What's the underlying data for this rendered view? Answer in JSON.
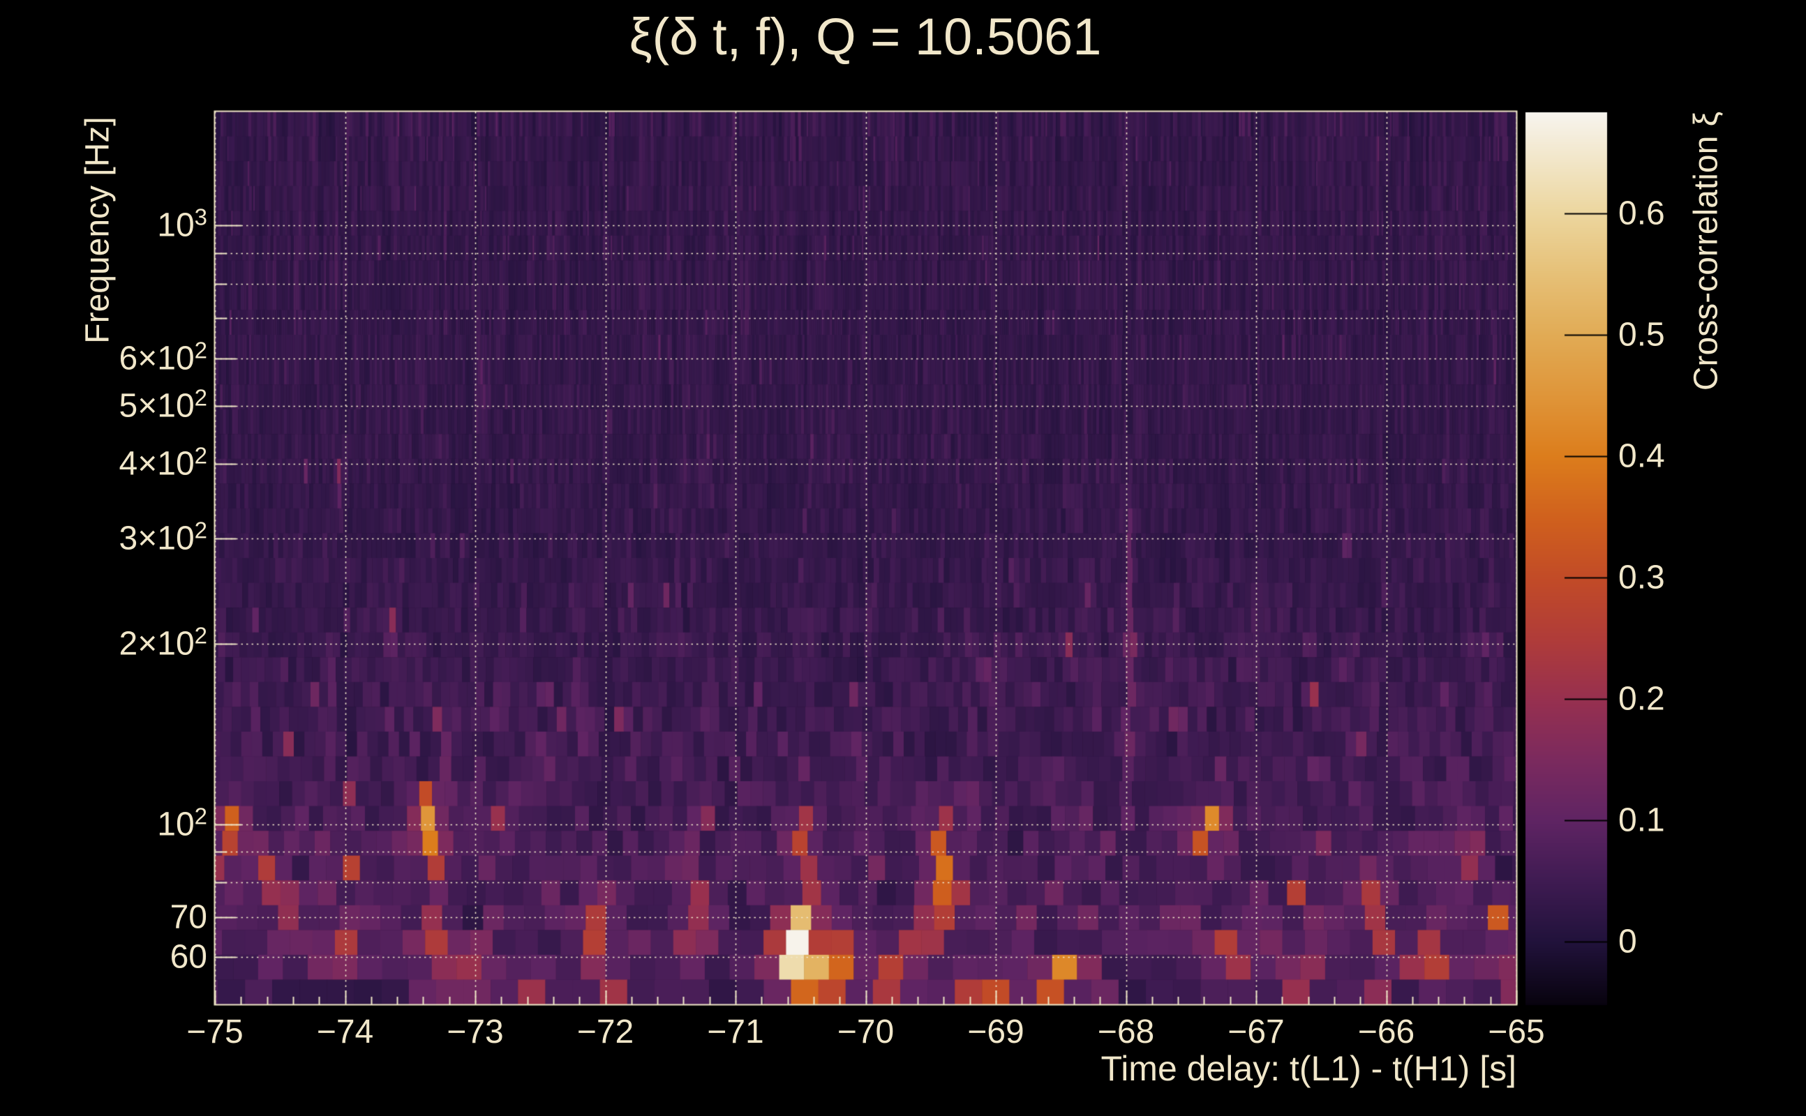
{
  "colors": {
    "background": "#000000",
    "text": "#f1e7ca",
    "grid": "#f1e7ca",
    "frame": "#efe6c6",
    "colorbar_tick": "#000000"
  },
  "chart_data": {
    "type": "heatmap",
    "title": "ξ(δ t, f), Q = 10.5061",
    "q_value": 10.5061,
    "xlabel": "Time delay: t(L1) - t(H1) [s]",
    "ylabel": "Frequency [Hz]",
    "colorbar_label": "Cross-correlation ξ",
    "x_range_s": [
      -75,
      -65
    ],
    "x_minor_tick_step_s": 0.2,
    "y_range_hz": [
      50,
      1550
    ],
    "y_scale": "log",
    "grid": "dotted, at every labeled/decade-minor tick",
    "legend_position": "right colorbar",
    "x_ticks": [
      {
        "v": -75,
        "label": "−75"
      },
      {
        "v": -74,
        "label": "−74"
      },
      {
        "v": -73,
        "label": "−73"
      },
      {
        "v": -72,
        "label": "−72"
      },
      {
        "v": -71,
        "label": "−71"
      },
      {
        "v": -70,
        "label": "−70"
      },
      {
        "v": -69,
        "label": "−69"
      },
      {
        "v": -68,
        "label": "−68"
      },
      {
        "v": -67,
        "label": "−67"
      },
      {
        "v": -66,
        "label": "−66"
      },
      {
        "v": -65,
        "label": "−65"
      }
    ],
    "y_ticks": [
      {
        "v": 1000,
        "base": "10",
        "exp": "3"
      },
      {
        "v": 600,
        "base": "6×10",
        "exp": "2"
      },
      {
        "v": 500,
        "base": "5×10",
        "exp": "2"
      },
      {
        "v": 400,
        "base": "4×10",
        "exp": "2"
      },
      {
        "v": 300,
        "base": "3×10",
        "exp": "2"
      },
      {
        "v": 200,
        "base": "2×10",
        "exp": "2"
      },
      {
        "v": 100,
        "base": "10",
        "exp": "2"
      },
      {
        "v": 70,
        "label": "70"
      },
      {
        "v": 60,
        "label": "60"
      }
    ],
    "y_unlabeled_ticks_hz": [
      80,
      90,
      700,
      800,
      900
    ],
    "y_gridlines_hz": [
      60,
      70,
      80,
      90,
      100,
      200,
      300,
      400,
      500,
      600,
      700,
      800,
      900,
      1000
    ],
    "colorbar": {
      "vmin": -0.052,
      "vmax": 0.683,
      "ticks": [
        {
          "v": 0.6,
          "label": "0.6"
        },
        {
          "v": 0.5,
          "label": "0.5"
        },
        {
          "v": 0.4,
          "label": "0.4"
        },
        {
          "v": 0.3,
          "label": "0.3"
        },
        {
          "v": 0.2,
          "label": "0.2"
        },
        {
          "v": 0.1,
          "label": "0.1"
        },
        {
          "v": 0.0,
          "label": "0"
        }
      ]
    },
    "colormap_stops": [
      [
        -0.052,
        "#08030e"
      ],
      [
        0.0,
        "#21123b"
      ],
      [
        0.05,
        "#3f1b52"
      ],
      [
        0.1,
        "#5f2463"
      ],
      [
        0.15,
        "#7b2a5e"
      ],
      [
        0.2,
        "#97304f"
      ],
      [
        0.25,
        "#b03c39"
      ],
      [
        0.3,
        "#c24b27"
      ],
      [
        0.35,
        "#d0611d"
      ],
      [
        0.4,
        "#dc7d1c"
      ],
      [
        0.45,
        "#df9539"
      ],
      [
        0.5,
        "#e1ab55"
      ],
      [
        0.55,
        "#e6c077"
      ],
      [
        0.6,
        "#ecd69e"
      ],
      [
        0.683,
        "#f7f4ee"
      ]
    ],
    "features": [
      {
        "t": -74.91,
        "f1": 88,
        "f2": 112,
        "v": 0.4
      },
      {
        "t": -74.6,
        "f1": 72,
        "f2": 95,
        "v": 0.27
      },
      {
        "t": -74.42,
        "f1": 62,
        "f2": 82,
        "v": 0.22
      },
      {
        "t": -74.3,
        "f1": 360,
        "f2": 400,
        "v": 0.12
      },
      {
        "t": -74.05,
        "f1": 340,
        "f2": 420,
        "v": 0.15
      },
      {
        "t": -73.95,
        "f1": 55,
        "f2": 72,
        "v": 0.24
      },
      {
        "t": -73.65,
        "f1": 195,
        "f2": 240,
        "v": 0.16
      },
      {
        "t": -73.35,
        "f1": 80,
        "f2": 118,
        "v": 0.46
      },
      {
        "t": -73.3,
        "f1": 50,
        "f2": 80,
        "v": 0.22
      },
      {
        "t": -73.0,
        "f1": 52,
        "f2": 66,
        "v": 0.2
      },
      {
        "t": -72.65,
        "f1": 50,
        "f2": 58,
        "v": 0.24
      },
      {
        "t": -72.35,
        "f1": 135,
        "f2": 160,
        "v": 0.14
      },
      {
        "t": -72.1,
        "f1": 55,
        "f2": 78,
        "v": 0.26
      },
      {
        "t": -71.85,
        "f1": 50,
        "f2": 58,
        "v": 0.21
      },
      {
        "t": -71.55,
        "f1": 230,
        "f2": 260,
        "v": 0.13
      },
      {
        "t": -71.3,
        "f1": 55,
        "f2": 92,
        "v": 0.19
      },
      {
        "t": -70.47,
        "f1": 50,
        "f2": 78,
        "v": 0.67
      },
      {
        "t": -70.47,
        "f1": 78,
        "f2": 108,
        "v": 0.3
      },
      {
        "t": -70.23,
        "f1": 50,
        "f2": 66,
        "v": 0.37
      },
      {
        "t": -70.1,
        "f1": 150,
        "f2": 175,
        "v": 0.14
      },
      {
        "t": -69.85,
        "f1": 50,
        "f2": 62,
        "v": 0.32
      },
      {
        "t": -69.62,
        "f1": 58,
        "f2": 76,
        "v": 0.24
      },
      {
        "t": -69.43,
        "f1": 58,
        "f2": 112,
        "v": 0.34
      },
      {
        "t": -69.1,
        "f1": 50,
        "f2": 56,
        "v": 0.27
      },
      {
        "t": -69.05,
        "f1": 160,
        "f2": 190,
        "v": 0.12
      },
      {
        "t": -68.5,
        "f1": 50,
        "f2": 62,
        "v": 0.44
      },
      {
        "t": -68.3,
        "f1": 230,
        "f2": 270,
        "v": 0.12
      },
      {
        "t": -67.97,
        "f1": 90,
        "f2": 420,
        "v": 0.13
      },
      {
        "t": -67.6,
        "f1": 140,
        "f2": 165,
        "v": 0.12
      },
      {
        "t": -67.38,
        "f1": 88,
        "f2": 112,
        "v": 0.4
      },
      {
        "t": -67.2,
        "f1": 52,
        "f2": 66,
        "v": 0.23
      },
      {
        "t": -66.6,
        "f1": 50,
        "f2": 60,
        "v": 0.25
      },
      {
        "t": -66.3,
        "f1": 280,
        "f2": 320,
        "v": 0.11
      },
      {
        "t": -66.15,
        "f1": 64,
        "f2": 86,
        "v": 0.29
      },
      {
        "t": -65.7,
        "f1": 52,
        "f2": 70,
        "v": 0.25
      },
      {
        "t": -65.55,
        "f1": 150,
        "f2": 180,
        "v": 0.12
      },
      {
        "t": -65.35,
        "f1": 78,
        "f2": 100,
        "v": 0.19
      },
      {
        "t": -65.08,
        "f1": 50,
        "f2": 60,
        "v": 0.21
      }
    ],
    "noise": {
      "seed": 7,
      "rows": 36,
      "tile_width_s": "11 / f_center, min 2.1px max 40px",
      "description": "Q-transform tile noise; mostly ξ≈0–0.08 (dark purple), amplitude and spike rate increase below ~250 Hz"
    }
  }
}
